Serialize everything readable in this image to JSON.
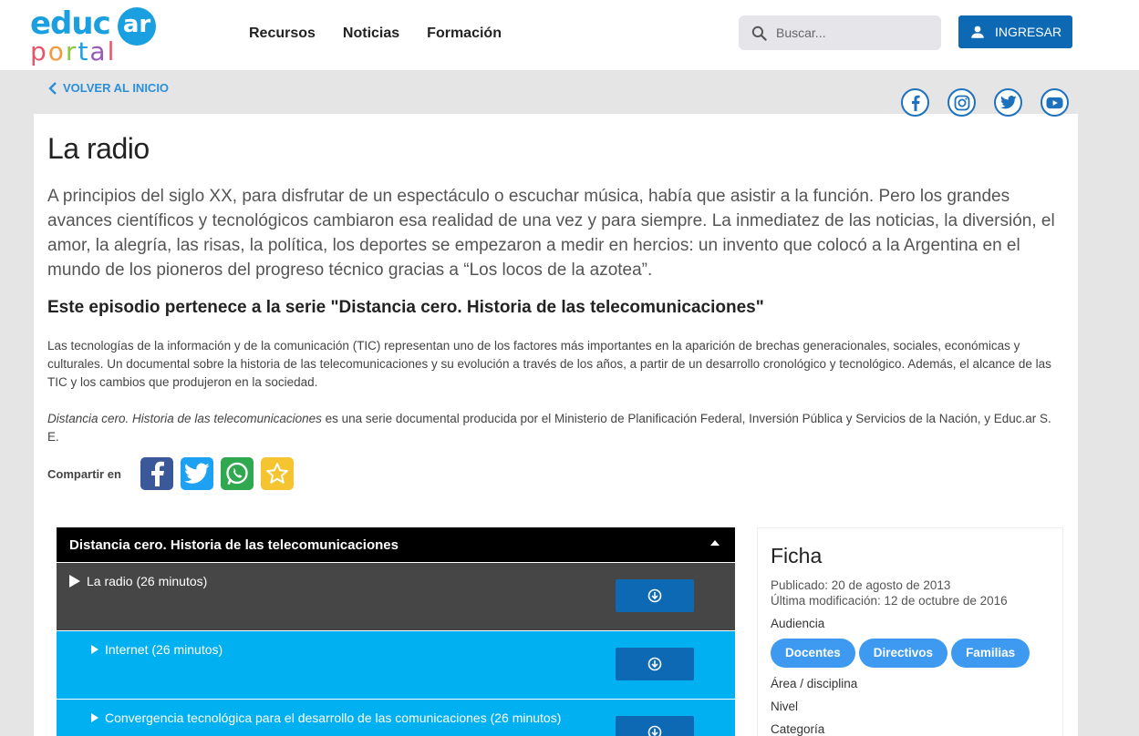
{
  "header": {
    "logo": {
      "top": "educ",
      "badge": "ar",
      "bottom": [
        "p",
        "o",
        "r",
        "t",
        "a",
        "l"
      ]
    },
    "nav": [
      "Recursos",
      "Noticias",
      "Formación"
    ],
    "search_placeholder": "Buscar...",
    "login_label": "INGRESAR"
  },
  "back_label": "VOLVER AL INICIO",
  "social": [
    "facebook-icon",
    "instagram-icon",
    "twitter-icon",
    "youtube-icon"
  ],
  "article": {
    "title": "La radio",
    "intro": "A principios del siglo XX, para disfrutar de un espectáculo o escuchar música, había que asistir a la función. Pero los grandes avances científicos y tecnológicos cambiaron esa realidad de una vez y para siempre. La inmediatez de las noticias, la diversión, el amor, la alegría, las risas, la política, los deportes se empezaron a medir en hercios: un invento que colocó a la Argentina en el mundo de los pioneros del progreso técnico gracias a “Los locos de la azotea”.",
    "series_heading": "Este episodio pertenece a la serie \"Distancia cero. Historia de las telecomunicaciones\"",
    "description": "Las tecnologías de la información y de la comunicación (TIC) representan uno de los factores más importantes en la aparición de brechas generacionales, sociales, económicas y culturales. Un documental sobre la historia de las telecomunicaciones y su evolución a través de los años, a partir de un desarrollo cronológico y tecnológico. Además, el alcance de las TIC y los cambios que produjeron en la sociedad.",
    "credit_italic": "Distancia cero. Historia de las telecomunicaciones",
    "credit_rest": " es una serie documental producida por el Ministerio de Planificación Federal, Inversión Pública y Servicios de la Nación, y Educ.ar S. E.",
    "share_label": "Compartir en"
  },
  "playlist": {
    "title": "Distancia cero. Historia de las telecomunicaciones",
    "items": [
      {
        "label": "La radio (26 minutos)"
      },
      {
        "label": "Internet (26 minutos)"
      },
      {
        "label": "Convergencia tecnológica para el desarrollo de las comunicaciones (26 minutos)"
      }
    ]
  },
  "ficha": {
    "title": "Ficha",
    "published": "Publicado: 20 de agosto de 2013",
    "modified": "Última modificación: 12 de octubre de 2016",
    "audience_label": "Audiencia",
    "tags": [
      "Docentes",
      "Directivos",
      "Familias"
    ],
    "area_label": "Área / disciplina",
    "level_label": "Nivel",
    "category_label": "Categoría"
  }
}
